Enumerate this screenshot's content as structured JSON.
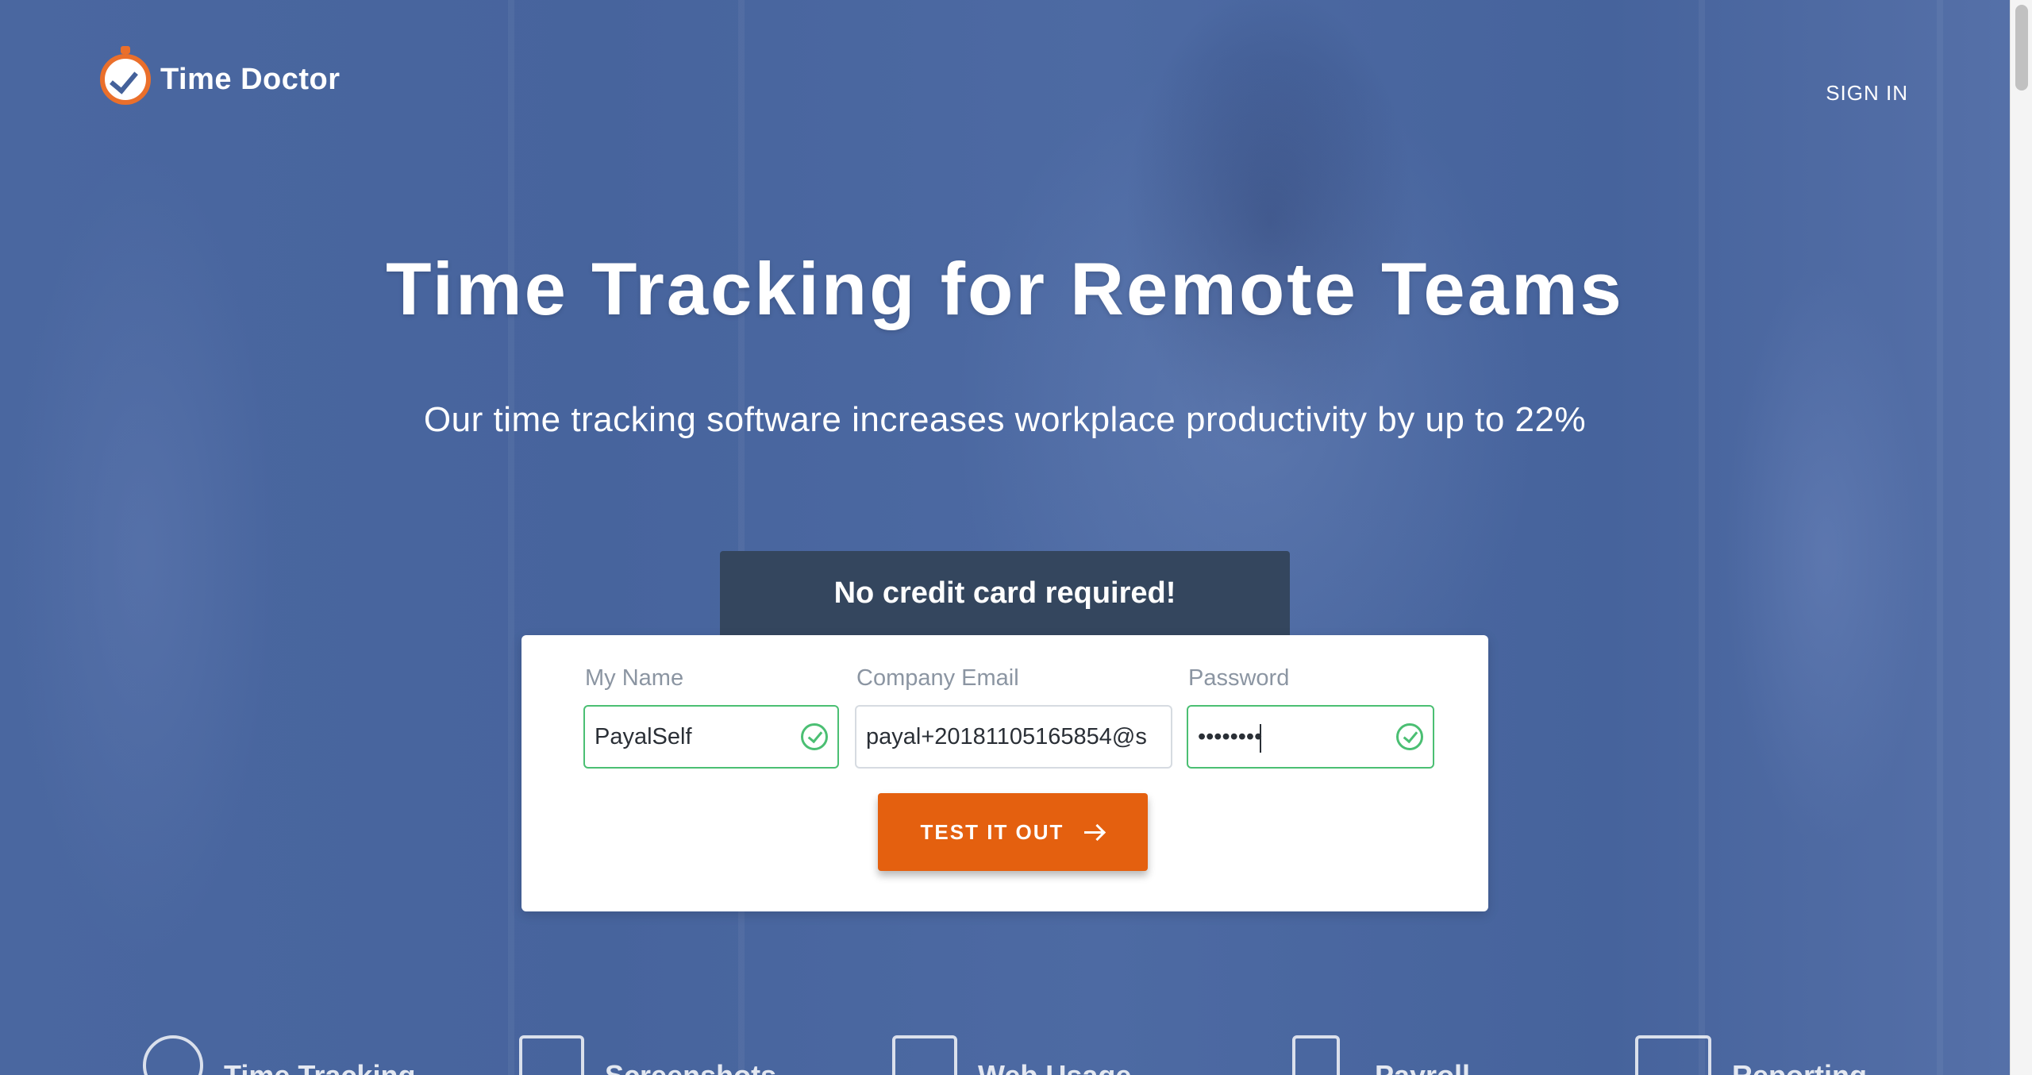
{
  "brand": {
    "name": "Time Doctor",
    "logo_icon": "clock-check-icon",
    "accent": "#ea6f2b",
    "hero_blue": "#44619a"
  },
  "header": {
    "signin_label": "SIGN IN"
  },
  "hero": {
    "title": "Time Tracking for Remote Teams",
    "subtitle": "Our time tracking software increases workplace productivity by up to 22%"
  },
  "signup": {
    "banner": "No credit card required!",
    "fields": {
      "name": {
        "label": "My Name",
        "value": "PayalSelf",
        "valid": true
      },
      "email": {
        "label": "Company Email",
        "value": "payal+20181105165854@s",
        "valid": false
      },
      "password": {
        "label": "Password",
        "value": "••••••••",
        "valid": true
      }
    },
    "cta_label": "TEST IT OUT",
    "cta_color": "#e4600f",
    "valid_color": "#4bbf73"
  },
  "features": [
    {
      "label": "Time Tracking",
      "icon": "stopwatch-icon"
    },
    {
      "label": "Screenshots",
      "icon": "image-icon"
    },
    {
      "label": "Web Usage",
      "icon": "browser-www-icon"
    },
    {
      "label": "Payroll",
      "icon": "payroll-icon"
    },
    {
      "label": "Reporting",
      "icon": "chart-line-icon"
    }
  ]
}
